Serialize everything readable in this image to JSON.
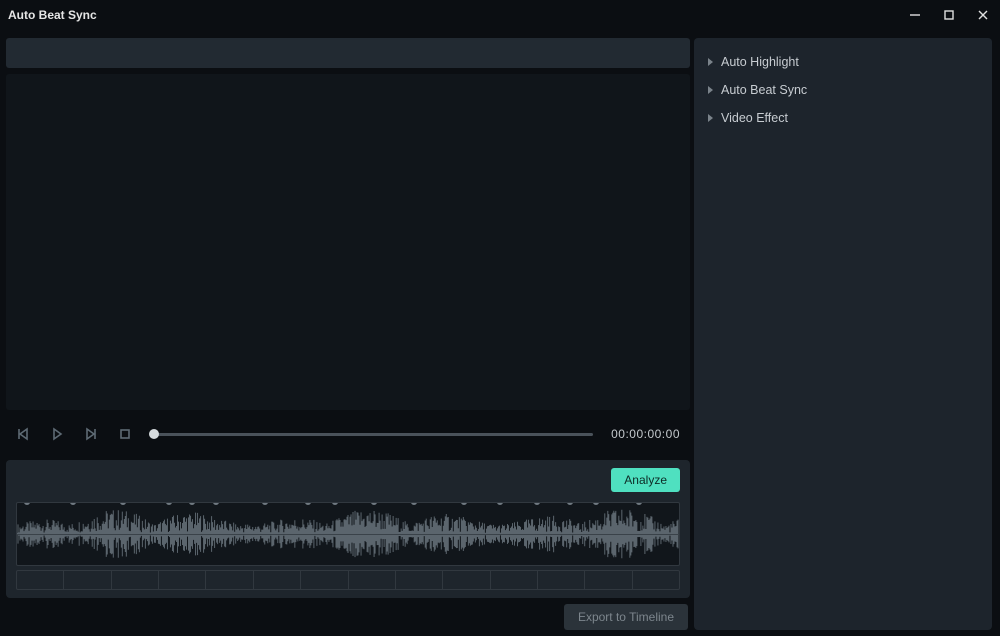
{
  "window": {
    "title": "Auto Beat Sync"
  },
  "playback": {
    "timecode": "00:00:00:00"
  },
  "wave": {
    "analyze_label": "Analyze",
    "marker_positions_pct": [
      1.5,
      8.5,
      16,
      23,
      26.5,
      30,
      37.5,
      44,
      48,
      54,
      60,
      67.5,
      73,
      78.5,
      83.5,
      87.5,
      94
    ],
    "segment_count": 14
  },
  "actions": {
    "export_label": "Export to Timeline"
  },
  "sidebar": {
    "items": [
      {
        "label": "Auto Highlight"
      },
      {
        "label": "Auto Beat Sync"
      },
      {
        "label": "Video Effect"
      }
    ]
  }
}
